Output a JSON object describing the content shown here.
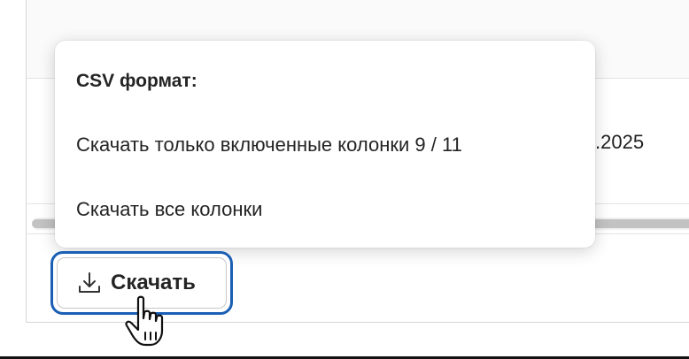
{
  "table": {
    "visible_cell_text": ".2025"
  },
  "menu": {
    "heading": "CSV формат:",
    "items": [
      {
        "label": "Скачать только включенные колонки 9 / 11"
      },
      {
        "label": "Скачать все колонки"
      }
    ]
  },
  "download_button": {
    "label": "Скачать",
    "icon": "download-icon"
  },
  "cursor": {
    "type": "hand-pointer-icon"
  },
  "colors": {
    "focus_ring": "#1a5fb4",
    "text": "#242424"
  }
}
